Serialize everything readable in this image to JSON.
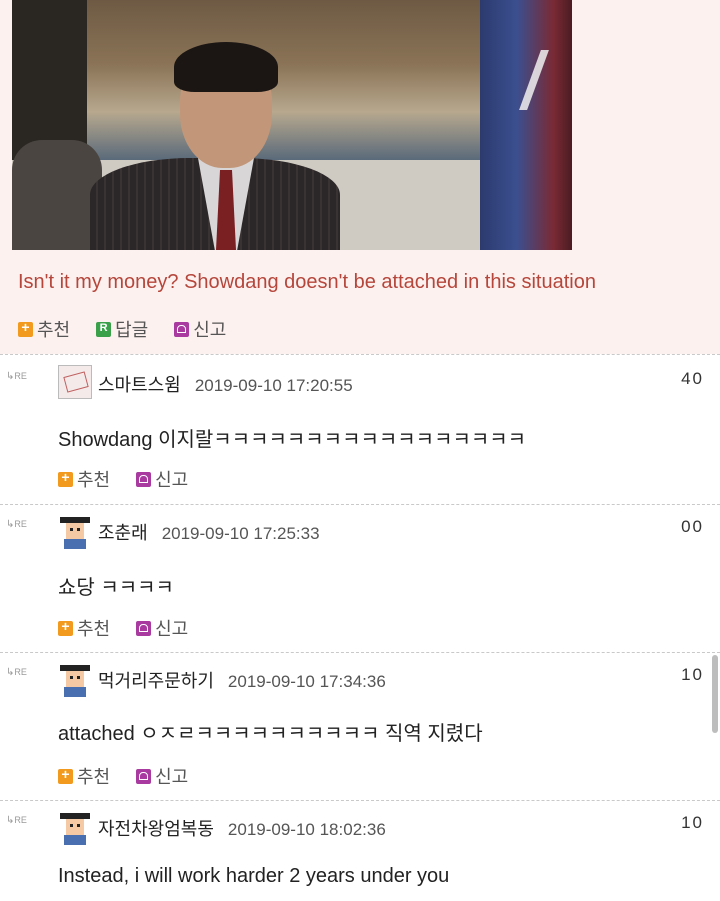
{
  "post": {
    "text": "Isn't it my money? Showdang doesn't be attached in this situation",
    "actions": [
      "추천",
      "답글",
      "신고"
    ]
  },
  "comments": [
    {
      "tag": "RE",
      "nickname": "스마트스윔",
      "date": "2019-09-10 17:20:55",
      "score": "40",
      "text": "Showdang 이지랄ㅋㅋㅋㅋㅋㅋㅋㅋㅋㅋㅋㅋㅋㅋㅋㅋㅋ",
      "actions": [
        "추천",
        "신고"
      ]
    },
    {
      "tag": "RE",
      "nickname": "조춘래",
      "date": "2019-09-10 17:25:33",
      "score": "00",
      "text": "쇼당 ㅋㅋㅋㅋ",
      "actions": [
        "추천",
        "신고"
      ]
    },
    {
      "tag": "RE",
      "nickname": "먹거리주문하기",
      "date": "2019-09-10 17:34:36",
      "score": "10",
      "text": "attached ㅇㅈㄹㅋㅋㅋㅋㅋㅋㅋㅋㅋㅋ 직역 지렸다",
      "actions": [
        "추천",
        "신고"
      ]
    },
    {
      "tag": "RE",
      "nickname": "자전차왕엄복동",
      "date": "2019-09-10 18:02:36",
      "score": "10",
      "text": "Instead, i will work harder 2 years under you",
      "actions": []
    }
  ],
  "icons": {
    "recommend": "plus-icon",
    "reply": "reply-icon",
    "report": "report-icon"
  },
  "colors": {
    "post_bg": "#fdf1ef",
    "post_text": "#b5463b",
    "recommend_icon": "#f19a1e",
    "reply_icon": "#3aa14a",
    "report_icon": "#a83aa0"
  }
}
